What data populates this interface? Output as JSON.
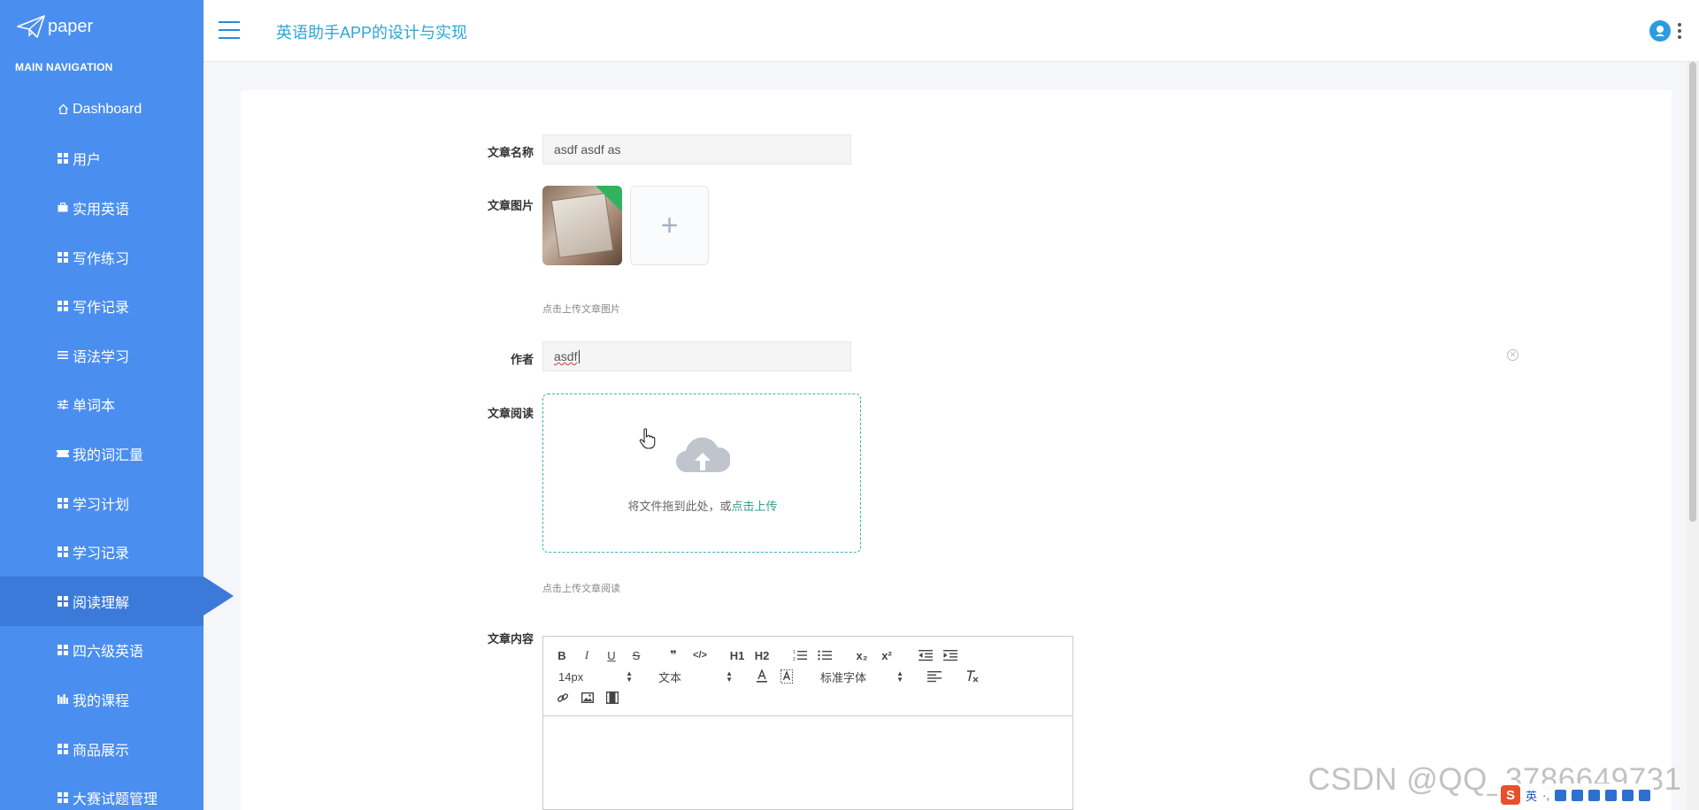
{
  "app": {
    "logo_text": "paper",
    "title": "英语助手APP的设计与实现"
  },
  "sidebar": {
    "header": "MAIN NAVIGATION",
    "items": [
      {
        "label": "Dashboard",
        "icon": "home-icon"
      },
      {
        "label": "用户",
        "icon": "grid-icon"
      },
      {
        "label": "实用英语",
        "icon": "briefcase-icon"
      },
      {
        "label": "写作练习",
        "icon": "grid-icon"
      },
      {
        "label": "写作记录",
        "icon": "grid-icon"
      },
      {
        "label": "语法学习",
        "icon": "list-icon"
      },
      {
        "label": "单词本",
        "icon": "sliders-icon"
      },
      {
        "label": "我的词汇量",
        "icon": "ticket-icon"
      },
      {
        "label": "学习计划",
        "icon": "grid-icon"
      },
      {
        "label": "学习记录",
        "icon": "grid-icon"
      },
      {
        "label": "阅读理解",
        "icon": "grid-icon",
        "active": true
      },
      {
        "label": "四六级英语",
        "icon": "grid-icon"
      },
      {
        "label": "我的课程",
        "icon": "bar-chart-icon"
      },
      {
        "label": "商品展示",
        "icon": "grid-icon"
      },
      {
        "label": "大赛试题管理",
        "icon": "grid-icon"
      }
    ]
  },
  "form": {
    "title_label": "文章名称",
    "title_value": "asdf asdf as",
    "image_label": "文章图片",
    "image_hint": "点击上传文章图片",
    "author_label": "作者",
    "author_value": "asdf",
    "reading_label": "文章阅读",
    "drop_text": "将文件拖到此处，或",
    "drop_link": "点击上传",
    "reading_hint": "点击上传文章阅读",
    "content_label": "文章内容"
  },
  "editor": {
    "buttons": [
      "B",
      "I",
      "U",
      "S",
      "❞",
      "</>",
      "H1",
      "H2",
      "ordered-list",
      "bullet-list",
      "x₂",
      "x²",
      "outdent",
      "indent"
    ],
    "size_select": "14px",
    "format_select": "文本",
    "font_select": "标准字体"
  },
  "watermark": "CSDN @QQ_3786649731",
  "ime": {
    "mode": "英"
  },
  "colors": {
    "sidebar_bg": "#4a8ef0",
    "sidebar_active": "#3b7ad9",
    "title_color": "#2ea6d6",
    "upload_link": "#2e9f8f"
  }
}
